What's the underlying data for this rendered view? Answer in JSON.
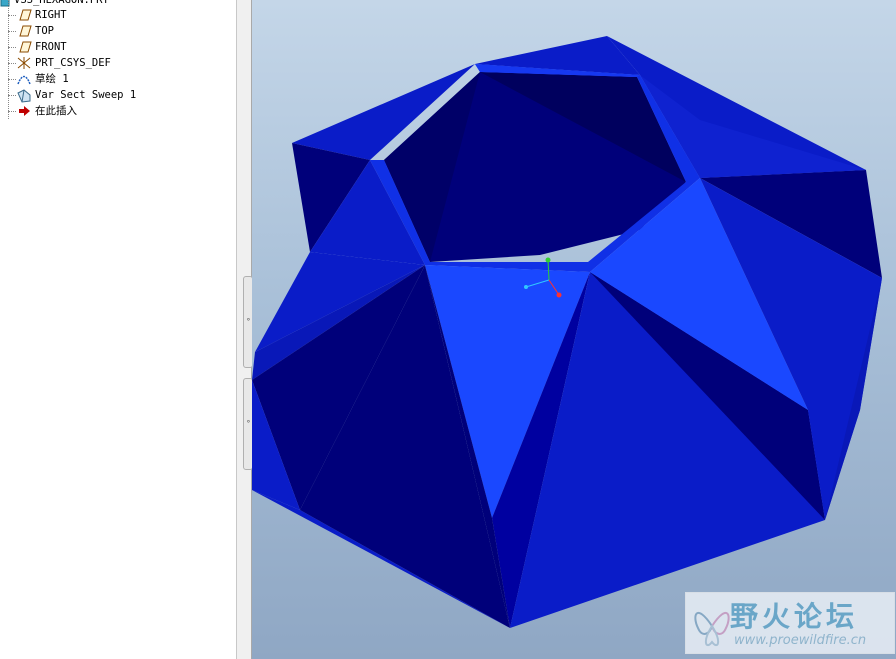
{
  "model_tree": {
    "root_label": "VSS_HEXAGON.PRT",
    "items": [
      {
        "label": "RIGHT",
        "icon": "datum-plane-icon"
      },
      {
        "label": "TOP",
        "icon": "datum-plane-icon"
      },
      {
        "label": "FRONT",
        "icon": "datum-plane-icon"
      },
      {
        "label": "PRT_CSYS_DEF",
        "icon": "coordinate-system-icon"
      },
      {
        "label": "草绘 1",
        "icon": "sketch-icon"
      },
      {
        "label": "Var Sect Sweep 1",
        "icon": "var-sect-sweep-icon"
      },
      {
        "label": "在此插入",
        "icon": "insert-here-arrow-icon"
      }
    ]
  },
  "watermark": {
    "title": "野火论坛",
    "url": "www.proewildfire.cn"
  },
  "colors": {
    "model_dark": "#00007a",
    "model_mid": "#0a1cc8",
    "model_light": "#1c4cff",
    "background_top": "#c4d6e8",
    "background_bottom": "#8fa7c4"
  }
}
